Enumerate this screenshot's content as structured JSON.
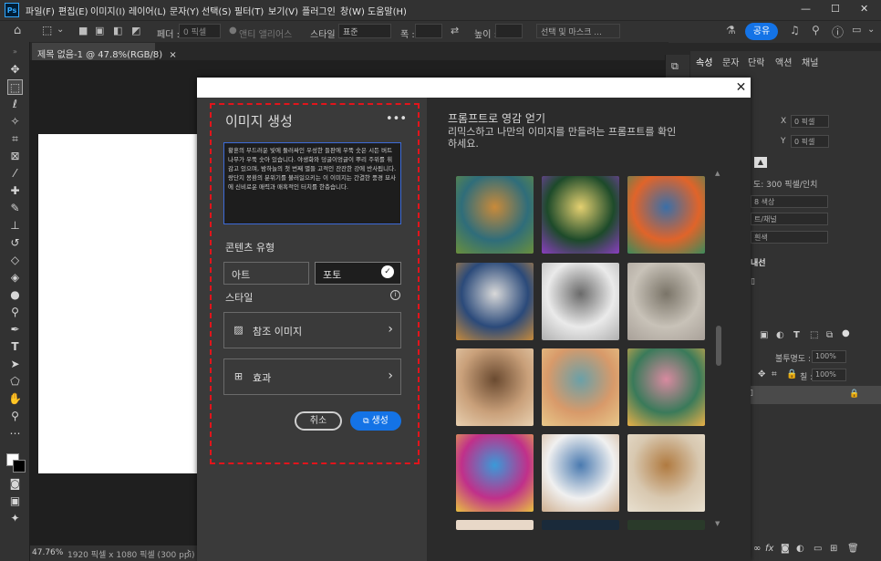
{
  "app": {
    "logo": "Ps"
  },
  "menu": [
    "파일(F)",
    "편집(E)",
    "이미지(I)",
    "레이어(L)",
    "문자(Y)",
    "선택(S)",
    "필터(T)",
    "보기(V)",
    "플러그인",
    "창(W)",
    "도움말(H)"
  ],
  "window_controls": {
    "minimize": "—",
    "maximize": "☐",
    "close": "✕"
  },
  "options_bar": {
    "feather_label": "페더 :",
    "feather_value": "0 픽셀",
    "antialias_label": "앤티 앨리어스",
    "style_label": "스타일 :",
    "style_value": "표준",
    "width_label": "폭 :",
    "height_label": "높이 :",
    "select_mask_label": "선택 및 마스크 ...",
    "share_label": "공유"
  },
  "document": {
    "tab_title": "제목 없음-1 @ 47.8%(RGB/8)",
    "tab_close": "×",
    "zoom": "47.76%",
    "doc_info": "1920 픽셀 x 1080 픽셀 (300 ppi)",
    "nav_arrow": "›"
  },
  "right_panel": {
    "tabs": [
      "속성",
      "문자",
      "단락",
      "액션",
      "채널"
    ],
    "x_label": "X",
    "x_value": "0 픽셀",
    "y_label": "Y",
    "y_value": "0 픽셀",
    "resolution": "도: 300 픽셀/인치",
    "mode": "8 색상",
    "bits": "트/채널",
    "background": "흰색",
    "guides_label": "내선",
    "opacity_label": "불투명도 :",
    "opacity_value": "100%",
    "fill_label": "칠 :",
    "fill_value": "100%"
  },
  "dialog": {
    "close": "✕",
    "generate_panel": {
      "title": "이미지 생성",
      "more": "•••",
      "prompt": "황혼의 부드러운 빛에 둘러싸인 우성한 들판에 우뚝 솟은 시든 버트나무가 우뚝 솟아 있습니다. 야생화와 덩굴이엉글이 뿌리 주위를 휘감고 있으며, 밤하늘의 첫 번째 별들 고적인 잔잔한 강에 반사됩니다. 랑단지 몽환의 분위기를 불러일으키는 이 이미지는 간결한 풍경 묘사에 신비로운 매력과 매혹적인 터치를 한층습니다.",
      "content_type_label": "콘텐츠 유형",
      "content_types": [
        "아트",
        "포토"
      ],
      "selected_content_type": "포토",
      "style_label": "스타일",
      "reference_image_label": "참조 이미지",
      "effects_label": "효과",
      "cancel_label": "취소",
      "generate_label": "생성"
    },
    "inspiration": {
      "title": "프롬프트로 영감 얻기",
      "description": "리믹스하고 나만의 이미지를 만들려는 프롬프트를 확인하세요.",
      "thumbnails": [
        {
          "name": "dinosaur",
          "colors": [
            "#2f6d7a",
            "#c98a3a",
            "#6a8f3c"
          ]
        },
        {
          "name": "enchanted-forest",
          "colors": [
            "#1d4a2a",
            "#e4d070",
            "#8a3ec0"
          ]
        },
        {
          "name": "dragon-sunset",
          "colors": [
            "#e0642a",
            "#3a6fa8",
            "#3c8a5a"
          ]
        },
        {
          "name": "winter-cottage",
          "colors": [
            "#2b4a7a",
            "#d9d9d9",
            "#c78a3a"
          ]
        },
        {
          "name": "old-man-sketch",
          "colors": [
            "#eaeaea",
            "#6a6a6a",
            "#b0b0b0"
          ]
        },
        {
          "name": "bulldog-king",
          "colors": [
            "#c8c2b8",
            "#7a7468",
            "#a8a098"
          ]
        },
        {
          "name": "smiling-woman",
          "colors": [
            "#c9a07a",
            "#6a4a30",
            "#e8d0b0"
          ]
        },
        {
          "name": "retro-trailer",
          "colors": [
            "#d89a6a",
            "#6aa0a8",
            "#e8c88a"
          ]
        },
        {
          "name": "tree-landscape",
          "colors": [
            "#3a7a5a",
            "#d88aa0",
            "#e8b048"
          ]
        },
        {
          "name": "colorful-portrait",
          "colors": [
            "#c0308a",
            "#3a9ad8",
            "#e8c040"
          ]
        },
        {
          "name": "fashion-sketch",
          "colors": [
            "#f0f0f0",
            "#4a7ab0",
            "#d0b090"
          ]
        },
        {
          "name": "leopard-coat",
          "colors": [
            "#d8c8b0",
            "#b07a40",
            "#e8e0d0"
          ]
        }
      ]
    }
  }
}
